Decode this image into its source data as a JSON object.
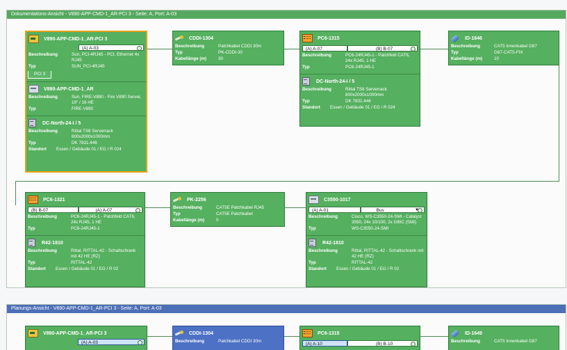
{
  "doc_view": {
    "header": "Dokumentations-Ansicht - V890-APP-CMD-1_AR-PCI 3 - Seite: A, Port: A-03",
    "row1": {
      "card1": {
        "title": "V890-APP-CMD-1_AR-PCI 3",
        "port": "(A) A-03",
        "beschreibung": "Sun, PCI-4RJ45 - PCI, Ethernet 4x RJ45",
        "typ": "SUN_PCI-4RJ45",
        "tab": "PCI 3",
        "server_title": "V890-APP-CMD-1_AR",
        "server_beschreibung": "Sun, FIRE-V890 - Fire V890 Server, 19\" / 16 HE",
        "server_typ": "FIRE-V890",
        "rack_title": "DC-North-24-I / 5",
        "rack_beschreibung": "Rittal TS8 Serverrack 800x2000x1000mm",
        "rack_typ": "DK 7831.446",
        "rack_standort": "Essen / Gebäude 01 / EG / R 024"
      },
      "card2": {
        "title": "CDDI-1304",
        "beschreibung": "Patchkabel CDDI 30m",
        "typ": "PK-CDDI-30",
        "kabellaenge": "30"
      },
      "card3": {
        "title": "PC6-1315",
        "port_a": "(A) A-07",
        "port_b": "(B) B-07",
        "beschreibung": "PC6-24RJ45-1 - Patchfeld CAT6, 24x RJ45, 1 HE",
        "typ": "PC6-24RJ45-1",
        "rack_title": "DC-North-24-I / 5",
        "rack_beschreibung": "Rittal TS8 Serverrack 800x2000x1000mm",
        "rack_typ": "DK 7831.446",
        "rack_standort": "Essen / Gebäude 01 / EG / R 024"
      },
      "card4": {
        "title": "ID-1646",
        "beschreibung": "CAT5 Innenkabel G87",
        "typ": "G87-CAT5-FIX",
        "kabellaenge": "10"
      }
    },
    "row2": {
      "card1": {
        "title": "PC6-1321",
        "port_b": "(B) B-07",
        "port_a": "(A) A-07",
        "beschreibung": "PC6-24RJ45-1 - Patchfeld CAT6, 24x RJ45, 1 HE",
        "typ": "PC6-24RJ45-1",
        "rack_title": "R42-1810",
        "rack_beschreibung": "Rittal, RITTAL-42 - Schaltschrank mit 42 HE (RZ)",
        "rack_typ": "RITTAL-42",
        "rack_standort": "Essen / Gebäude 01 / EG / R  02"
      },
      "card2": {
        "title": "PK-2256",
        "beschreibung": "CAT5E Patchkabel RJ45",
        "typ": "CAT5E Patchkabel",
        "kabellaenge": "0"
      },
      "card3": {
        "title": "C3550-1017",
        "port_a": "(A) A-01",
        "port_bus": "Bus",
        "beschreibung": "Cisco, WS-C3550-24-SMI - Catalyst 3550, 24x 10/100, 2x GBIC (SMI)",
        "typ": "WS-C3550-24-SMI",
        "rack_title": "R42-1810",
        "rack_beschreibung": "Rittal, RITTAL-42 - Schaltschrank mit 42 HE (RZ)",
        "rack_typ": "RITTAL-42",
        "rack_standort": "Essen / Gebäude 01 / EG / R  02"
      }
    }
  },
  "plan_view": {
    "header": "Planungs-Ansicht - V890-APP-CMD-1_AR-PCI 3 - Seite: A, Port: A-03",
    "card1": {
      "title": "V890-APP-CMD-1_AR-PCI 3",
      "port": "(A) A-03"
    },
    "card2": {
      "title": "CDDI-1304",
      "beschreibung": "Patchkabel CDDI 30m"
    },
    "card3": {
      "title": "PC6-1315",
      "port_a": "(A) A-10",
      "port_b": "(B) B-10"
    },
    "card4": {
      "title": "ID-1649",
      "beschreibung": "CAT5 Innenkabel G87"
    }
  },
  "labels": {
    "beschreibung": "Beschreibung",
    "typ": "Typ",
    "kabellaenge": "Kabellänge (m)",
    "standort": "Standort"
  },
  "colors": {
    "doc_header": "#55a85e",
    "plan_header": "#4d6fb7",
    "card": "#55b05f",
    "selected_border": "#e7a019"
  }
}
